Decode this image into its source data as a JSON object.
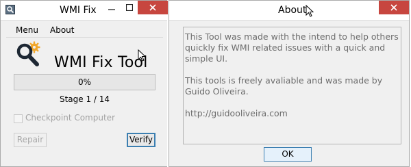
{
  "wmi_window": {
    "title": "WMI Fix",
    "icons": {
      "app": "app-icon",
      "minimize": "minimize-icon",
      "maximize": "maximize-icon",
      "close": "close-icon",
      "logo": "magnifier-gear-icon"
    },
    "menu": [
      "Menu",
      "About"
    ],
    "app_title": "WMI Fix Tool",
    "progress": {
      "value_percent": 0,
      "label": "0%"
    },
    "stage_label": "Stage 1 / 14",
    "checkbox": {
      "label": "Checkpoint Computer",
      "checked": false,
      "enabled": false
    },
    "buttons": {
      "repair": "Repair",
      "verify": "Verify"
    }
  },
  "about_window": {
    "title": "About",
    "paragraphs": [
      "This Tool was made with the intend to help others quickly fix WMI related issues with a quick and simple UI.",
      "This tools is freely avaliable and was made by Guido Oliveira.",
      "http://guidooliveira.com"
    ],
    "ok_button": "OK"
  },
  "colors": {
    "close_red": "#c7463f",
    "text_gray": "#6d6d6d",
    "focus_blue": "#3c7fb1"
  }
}
